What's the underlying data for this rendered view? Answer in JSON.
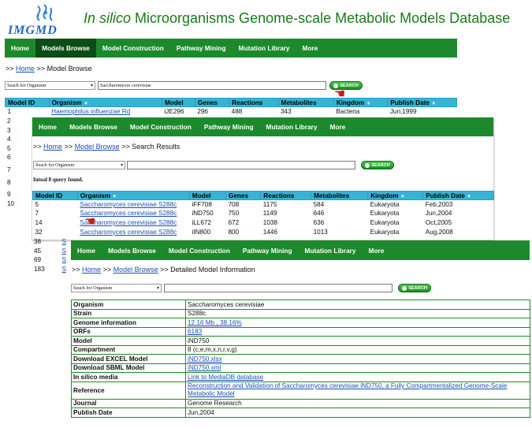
{
  "header": {
    "logo_text": "IMGMD",
    "title_italic": "In silico",
    "title_rest": " Microorganisms Genome-scale Metabolic Models Database"
  },
  "nav": [
    "Home",
    "Models Browse",
    "Model Construction",
    "Pathway Mining",
    "Mutation Library",
    "More"
  ],
  "search": {
    "select_label": "Seach for Organism",
    "button_label": "SEARCH"
  },
  "panel1": {
    "crumb_home": "Home",
    "crumb_sep": ">>",
    "crumb_current": "Model Browse",
    "query": "Saccharomyces cerevisiae",
    "columns": [
      "Model ID",
      "Organism",
      "Model",
      "Genes",
      "Reactions",
      "Metabolites",
      "Kingdom",
      "Publish Date"
    ],
    "first_row": {
      "id": "1",
      "organism": "Haemophilus influenzae Rd",
      "model": "iJE296",
      "genes": "296",
      "reactions": "488",
      "metabolites": "343",
      "kingdom": "Bacteria",
      "date": "Jun,1999"
    },
    "ids": [
      "2",
      "3",
      "4",
      "5",
      "6",
      "7",
      "8",
      "9",
      "10"
    ]
  },
  "panel2": {
    "crumb_home": "Home",
    "crumb_browse": "Model Browse",
    "crumb_current": "Search Results",
    "found_text": "Intoal 8 query found.",
    "rows": [
      {
        "id": "5",
        "organism": "Saccharomyces cerevisiae S288c",
        "model": "iFF708",
        "genes": "708",
        "reactions": "1175",
        "metabolites": "584",
        "kingdom": "Eukaryota",
        "date": "Feb,2003"
      },
      {
        "id": "7",
        "organism": "Saccharomyces cerevisiae S288c",
        "model": "iND750",
        "genes": "750",
        "reactions": "1149",
        "metabolites": "646",
        "kingdom": "Eukaryota",
        "date": "Jun,2004"
      },
      {
        "id": "14",
        "organism": "Saccharomyces cerevisiae S288c",
        "model": "iLL672",
        "genes": "672",
        "reactions": "1038",
        "metabolites": "636",
        "kingdom": "Eukaryota",
        "date": "Oct,2005"
      },
      {
        "id": "32",
        "organism": "Saccharomyces cerevisiae S288c",
        "model": "iIN800",
        "genes": "800",
        "reactions": "1446",
        "metabolites": "1013",
        "kingdom": "Eukaryota",
        "date": "Aug,2008"
      }
    ],
    "extra_ids": [
      "38",
      "45",
      "69",
      "183"
    ],
    "extra_org": "S"
  },
  "panel3": {
    "crumb_home": "Home",
    "crumb_browse": "Model Browse",
    "crumb_current": "Detailed Model Information",
    "rows": [
      {
        "key": "Organism",
        "value": "Saccharomyces cerevisiae",
        "link": false
      },
      {
        "key": "Strain",
        "value": "S288c",
        "link": false
      },
      {
        "key": "Genome information",
        "value": "12.16 Mb , 38.16%",
        "link": true
      },
      {
        "key": "ORFs",
        "value": "6183",
        "link": true
      },
      {
        "key": "Model",
        "value": "iND750",
        "link": false
      },
      {
        "key": "Compartment",
        "value": "8 (c,e,m,x,n,r,v,g)",
        "link": false
      },
      {
        "key": "Download EXCEL Model",
        "value": "iND750.xlsx",
        "link": true
      },
      {
        "key": "Download SBML Model",
        "value": "iND750.xml",
        "link": true
      },
      {
        "key": "In silico media",
        "value": "Link to MediaDB database",
        "link": true
      },
      {
        "key": "Reference",
        "value": "Reconstruction and Validation of Saccharomyces cerevisiae iND750, a Fully Compartmentalized Genome-Scale Metabolic Model",
        "link": true
      },
      {
        "key": "Journal",
        "value": "Genome Research",
        "link": false
      },
      {
        "key": "Publish Date",
        "value": "Jun,2004",
        "link": false
      }
    ]
  },
  "colors": {
    "nav_green": "#1c8a2c",
    "nav_active": "#0b4d14",
    "header_blue": "#37b3d6",
    "title_green": "#1a7a1a"
  }
}
